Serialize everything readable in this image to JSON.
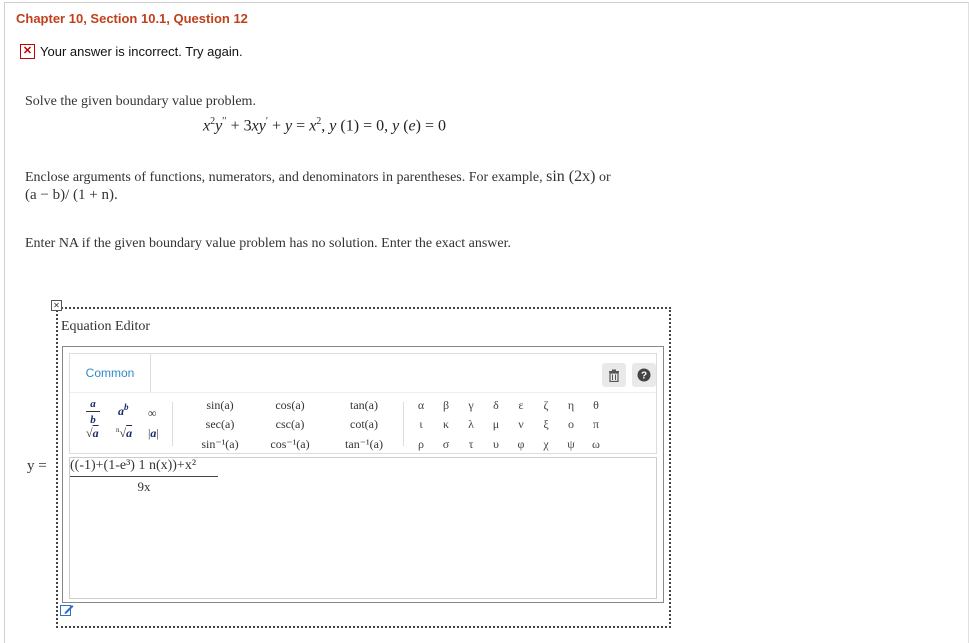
{
  "header": {
    "title": "Chapter 10, Section 10.1, Question 12"
  },
  "feedback": {
    "text": "Your answer is incorrect.  Try again."
  },
  "question": {
    "prompt": "Solve the given boundary value problem.",
    "instruction_1": "Enclose arguments of functions, numerators, and denominators in parentheses. For example,",
    "example_1": "sin (2x)",
    "instruction_or": "or",
    "example_2": "(a − b)/ (1 + n).",
    "instruction_2": "Enter NA if the given boundary value problem has no solution. Enter the exact answer."
  },
  "editor": {
    "title": "Equation Editor",
    "tab_common": "Common",
    "functions": [
      [
        "sin(a)",
        "cos(a)",
        "tan(a)"
      ],
      [
        "sec(a)",
        "csc(a)",
        "cot(a)"
      ],
      [
        "sin⁻¹(a)",
        "cos⁻¹(a)",
        "tan⁻¹(a)"
      ]
    ],
    "greek": [
      [
        "α",
        "β",
        "γ",
        "δ",
        "ε",
        "ζ",
        "η",
        "θ"
      ],
      [
        "ι",
        "κ",
        "λ",
        "μ",
        "ν",
        "ξ",
        "ο",
        "π"
      ],
      [
        "ρ",
        "σ",
        "τ",
        "υ",
        "φ",
        "χ",
        "ψ",
        "ω"
      ]
    ],
    "infinity": "∞",
    "abs": "|a|",
    "answer_label": "y =",
    "answer_numerator": "((-1)+(1-e³) 1 n(x))+x²",
    "answer_denominator": "9x"
  },
  "icons": {
    "trash": "trash-icon",
    "help": "help-icon",
    "close": "close-icon",
    "edit": "edit-icon",
    "error": "x-icon"
  }
}
